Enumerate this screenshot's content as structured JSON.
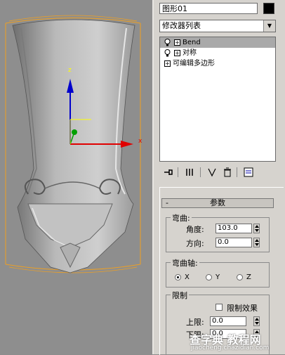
{
  "object_name": "图形01",
  "object_color": "#000000",
  "modifier_list": "修改器列表",
  "stack": [
    {
      "label": "Bend",
      "selected": true
    },
    {
      "label": "对称",
      "selected": false
    },
    {
      "label": "可编辑多边形",
      "selected": false
    }
  ],
  "viewport": {
    "axis_x": "x",
    "axis_y": "z",
    "colors": {
      "bbox": "#f0a020",
      "x": "#e00000",
      "y": "#00a000",
      "z": "#0000cc"
    }
  },
  "rollout": {
    "title": "参数",
    "collapse_symbol": "-",
    "bend_group": "弯曲:",
    "angle_label": "角度:",
    "angle_value": "103.0",
    "direction_label": "方向:",
    "direction_value": "0.0",
    "axis_group": "弯曲轴:",
    "axes": [
      {
        "label": "X",
        "checked": true
      },
      {
        "label": "Y",
        "checked": false
      },
      {
        "label": "Z",
        "checked": false
      }
    ],
    "limit_group": "限制",
    "limit_effect_label": "限制效果",
    "upper_label": "上限:",
    "upper_value": "0.0",
    "lower_label": "下限:",
    "lower_value": "0.0"
  },
  "watermark": {
    "text": "查字典 教程网",
    "url": "jiaocheng.chazidian.com"
  }
}
